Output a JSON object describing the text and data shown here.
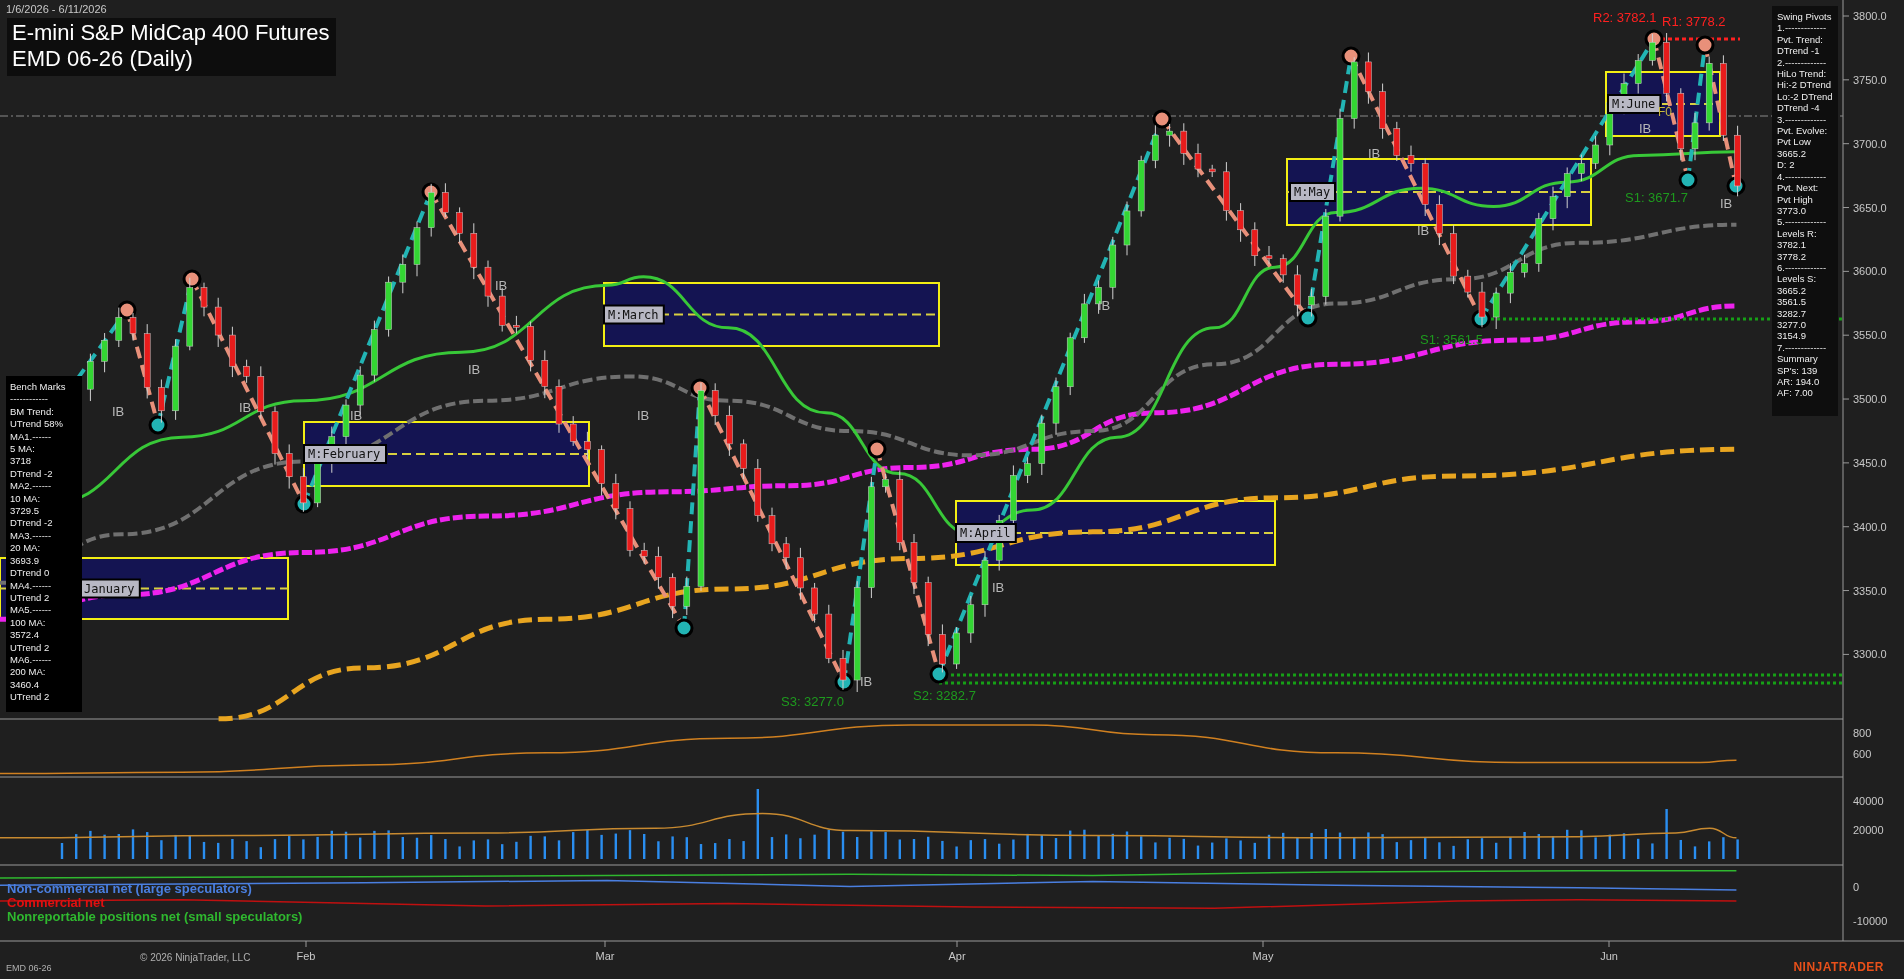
{
  "header": {
    "date_range": "1/6/2026 - 6/11/2026",
    "title": "E-mini S&P MidCap 400 Futures",
    "subtitle": "EMD 06-26 (Daily)"
  },
  "price_axis": {
    "labels": [
      "3800.0",
      "3750.0",
      "3700.0",
      "3650.0",
      "3600.0",
      "3550.0",
      "3500.0",
      "3450.0",
      "3400.0",
      "3350.0",
      "3300.0"
    ]
  },
  "month_zones": [
    {
      "label": "January"
    },
    {
      "label": "M:February"
    },
    {
      "label": "M:March"
    },
    {
      "label": "M:April"
    },
    {
      "label": "M:May"
    },
    {
      "label": "M:June"
    }
  ],
  "level_labels": [
    {
      "kind": "resistance",
      "text": "R2: 3782.1"
    },
    {
      "kind": "resistance",
      "text": "R1: 3778.2"
    },
    {
      "kind": "support",
      "text": "S1: 3671.7"
    },
    {
      "kind": "support",
      "text": "S1: 3561.5"
    },
    {
      "kind": "support",
      "text": "S2: 3282.7"
    },
    {
      "kind": "support",
      "text": "S3: 3277.0"
    }
  ],
  "ib_marks": [
    "IB",
    "IB",
    "IB",
    "IB",
    "IB",
    "IB",
    "IB",
    "IB",
    "IB",
    "IB",
    "IB",
    "IB",
    "IB"
  ],
  "fib_label": "F0",
  "bench_marks": {
    "lines": [
      "Bench Marks",
      "------------",
      "BM Trend:",
      "UTrend 58%",
      "MA1.------",
      "5 MA:",
      "3718",
      "DTrend -2",
      "MA2.------",
      "10 MA:",
      "3729.5",
      "DTrend -2",
      "MA3.------",
      "20 MA:",
      "3693.9",
      "DTrend 0",
      "MA4.------",
      "UTrend 2",
      "MA5.------",
      "100 MA:",
      "3572.4",
      "UTrend 2",
      "MA6.------",
      "200 MA:",
      "3460.4",
      "UTrend 2"
    ]
  },
  "swing_pivots": {
    "lines": [
      "Swing Pivots",
      "1.-------------",
      "Pvt. Trend:",
      "DTrend -1",
      "2.-------------",
      "HiLo Trend:",
      "Hi:-2 DTrend",
      "Lo:-2 DTrend",
      "DTrend -4",
      "3.-------------",
      "Pvt. Evolve:",
      "Pvt Low",
      "3665.2",
      "D: 2",
      "4.-------------",
      "Pvt. Next:",
      "Pvt High",
      "3773.0",
      "5.-------------",
      "Levels R:",
      "3782.1",
      "3778.2",
      "6.-------------",
      "Levels S:",
      "3665.2",
      "3561.5",
      "3282.7",
      "3277.0",
      "3154.9",
      "7.-------------",
      "Summary",
      "SP's: 139",
      "AR: 194.0",
      "AF: 7.00"
    ]
  },
  "indicator_axes": [
    [
      "800",
      "600"
    ],
    [
      "40000",
      "20000"
    ],
    [
      "0",
      "-10000"
    ]
  ],
  "legend": [
    {
      "text": "Non-commercial net (large speculators)",
      "color": "#4a7fe0"
    },
    {
      "text": "Commercial net",
      "color": "#e01010"
    },
    {
      "text": "Nonreportable positions net (small speculators)",
      "color": "#2fb82f"
    }
  ],
  "copyright": "© 2026 NinjaTrader, LLC",
  "x_axis": {
    "labels": [
      "Feb",
      "Mar",
      "Apr",
      "May",
      "Jun"
    ]
  },
  "footer": {
    "instrument": "EMD 06-26",
    "brand": "NINJATRADER"
  }
}
